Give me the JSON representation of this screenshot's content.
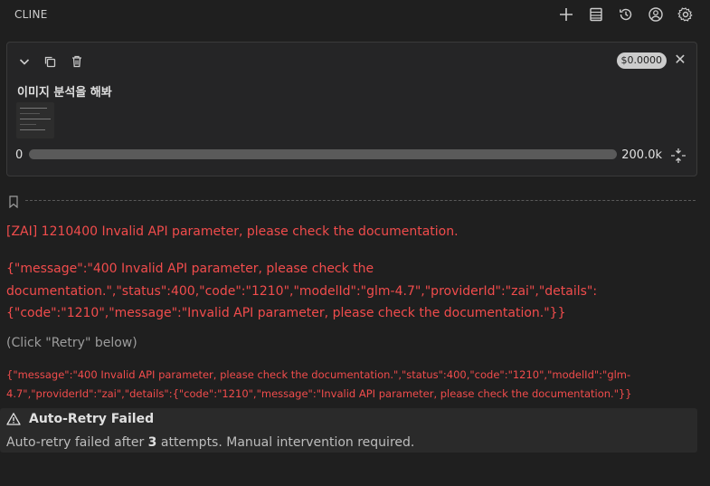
{
  "header": {
    "title": "CLINE",
    "icons": [
      "plus-icon",
      "history-list-icon",
      "history-clock-icon",
      "account-icon",
      "gear-icon"
    ]
  },
  "task": {
    "text": "이미지 분석을 해봐",
    "cost": "$0.0000",
    "context_used": "0",
    "context_window": "200.0k",
    "context_fill_fraction": 0.0
  },
  "error": {
    "title": "[ZAI] 1210400 Invalid API parameter, please check the documentation.",
    "json": "{\"message\":\"400 Invalid API parameter, please check the documentation.\",\"status\":400,\"code\":\"1210\",\"modelId\":\"glm-4.7\",\"providerId\":\"zai\",\"details\":{\"code\":\"1210\",\"message\":\"Invalid API parameter, please check the documentation.\"}}",
    "click_retry": "(Click \"Retry\" below)",
    "json_small": "{\"message\":\"400 Invalid API parameter, please check the documentation.\",\"status\":400,\"code\":\"1210\",\"modelId\":\"glm-4.7\",\"providerId\":\"zai\",\"details\":{\"code\":\"1210\",\"message\":\"Invalid API parameter, please check the documentation.\"}}"
  },
  "auto_retry": {
    "title": "Auto-Retry Failed",
    "msg_before": "Auto-retry failed after ",
    "attempts": "3",
    "msg_after": " attempts. Manual intervention required."
  },
  "colors": {
    "background": "#1f1f1f",
    "error": "#f14c4c",
    "card": "#252526"
  }
}
